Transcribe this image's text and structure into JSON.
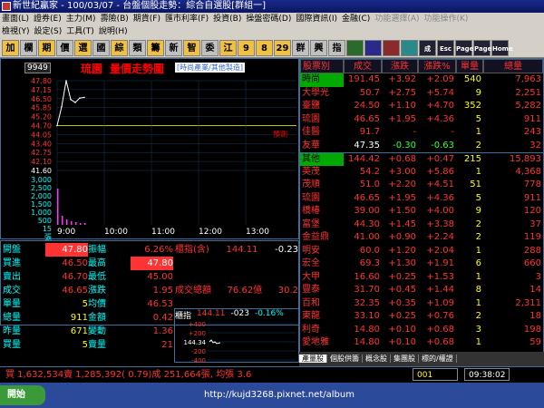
{
  "window": {
    "title": "新世紀贏家 - 100/03/07 - 台盤個股走勢：綜合自選股[群組一]"
  },
  "menu": {
    "row1": [
      "畫面(L)",
      "證券(E)",
      "主力(M)",
      "壽險(B)",
      "期貨(F)",
      "匯市利率(F)",
      "投資(B)",
      "操盤密碼(D)",
      "國際資訊(I)",
      "金融(C)",
      "功能選擇(A)",
      "功能操作(K)"
    ],
    "row2": [
      "檢視(Y)",
      "設定(S)",
      "工具(T)",
      "說明(H)"
    ]
  },
  "toolbar": {
    "buttons": [
      "加",
      "欄",
      "期",
      "價",
      "選",
      "國",
      "綜",
      "類",
      "籌",
      "新",
      "智",
      "委",
      "江",
      "9",
      "8",
      "29",
      "群",
      "興",
      "指",
      "",
      "",
      "",
      "",
      "成",
      "Esc",
      "Page Up",
      "Page Down",
      "Home"
    ]
  },
  "chart": {
    "code": "9949",
    "stock_name": "琉園",
    "chart_label": "量價走勢圖",
    "industry": "[時尚產業/其他製造]",
    "price_ticks": [
      "47.80",
      "47.15",
      "46.50",
      "45.85",
      "45.20",
      "44.70",
      "44.05",
      "43.40",
      "42.75",
      "42.10",
      "41.60"
    ],
    "volume_ticks": [
      "3,000",
      "2,500",
      "2,000",
      "1,500",
      "1,000",
      "500",
      "15",
      "張"
    ],
    "time_ticks": [
      "9:00",
      "10:00",
      "11:00",
      "12:00",
      "13:00"
    ],
    "extra_label": "預測"
  },
  "chart_data": {
    "type": "line",
    "x": [
      "9:00",
      "9:05",
      "9:10",
      "9:15",
      "9:20",
      "9:25",
      "9:30"
    ],
    "series": [
      {
        "values": [
          44.7,
          46.0,
          47.8,
          46.5,
          46.3,
          46.6,
          46.65
        ]
      }
    ],
    "ylim": [
      41.6,
      47.8
    ]
  },
  "info": {
    "left": [
      {
        "l": "開盤",
        "v1": "47.80",
        "l2": "振幅",
        "v2": "6.26%"
      },
      {
        "l": "買進",
        "v1": "46.50",
        "l2": "最高",
        "v2": "47.80"
      },
      {
        "l": "賣出",
        "v1": "46.70",
        "l2": "最低",
        "v2": "45.00"
      },
      {
        "l": "成交",
        "v1": "46.65",
        "l2": "漲跌",
        "v2": "1.95"
      },
      {
        "l": "單量",
        "v1": "5",
        "l2": "均價",
        "v2": "46.53"
      },
      {
        "l": "總量",
        "v1": "911",
        "l2": "金額",
        "v2": "0.42"
      },
      {
        "l": "昨量",
        "v1": "671",
        "l2": "變動",
        "v2": "1.36"
      },
      {
        "l": "買量",
        "v1": "5",
        "l2": "賣量",
        "v2": "21"
      }
    ],
    "right": {
      "index_label": "櫃指(含)",
      "index_val": "144.11",
      "index_chg": "-0.23",
      "total_label": "成交總額",
      "total_val": "76.62億",
      "total_pct": "30.2",
      "mini_label": "櫃指",
      "mini_val": "144.11",
      "mini_chg": "-023",
      "mini_pct": "-0.16%",
      "mini_ticks": [
        "+400",
        "+200",
        "144.34",
        "-200",
        "-400"
      ]
    }
  },
  "watchlist": {
    "headers": [
      "股票別",
      "成交",
      "漲跌",
      "漲跌%",
      "單量",
      "總量"
    ],
    "rows": [
      [
        "時尚",
        "191.45",
        "+3.92",
        "+2.09",
        "540",
        "7,963"
      ],
      [
        "大學光",
        "50.7",
        "+2.75",
        "+5.74",
        "9",
        "2,251"
      ],
      [
        "臺鹽",
        "24.50",
        "+1.10",
        "+4.70",
        "352",
        "5,282"
      ],
      [
        "琉園",
        "46.65",
        "+1.95",
        "+4.36",
        "5",
        "911"
      ],
      [
        "佳醫",
        "91.7",
        "-",
        "-",
        "1",
        "243"
      ],
      [
        "友華",
        "47.35",
        "-0.30",
        "-0.63",
        "2",
        "32"
      ],
      [
        "其他",
        "144.42",
        "+0.68",
        "+0.47",
        "215",
        "15,893"
      ],
      [
        "英茂",
        "54.2",
        "+3.00",
        "+5.86",
        "1",
        "4,368"
      ],
      [
        "茂順",
        "51.0",
        "+2.20",
        "+4.51",
        "51",
        "778"
      ],
      [
        "琉園",
        "46.65",
        "+1.95",
        "+4.36",
        "5",
        "911"
      ],
      [
        "橋椿",
        "39.00",
        "+1.50",
        "+4.00",
        "9",
        "120"
      ],
      [
        "富堡",
        "44.30",
        "+1.45",
        "+3.38",
        "2",
        "37"
      ],
      [
        "金益鼎",
        "41.00",
        "+0.90",
        "+2.24",
        "2",
        "119"
      ],
      [
        "明安",
        "60.0",
        "+1.20",
        "+2.04",
        "1",
        "288"
      ],
      [
        "宏全",
        "69.3",
        "+1.30",
        "+1.91",
        "6",
        "660"
      ],
      [
        "大甲",
        "16.60",
        "+0.25",
        "+1.53",
        "1",
        "3"
      ],
      [
        "豐泰",
        "31.70",
        "+0.45",
        "+1.44",
        "8",
        "14"
      ],
      [
        "百和",
        "32.35",
        "+0.35",
        "+1.09",
        "1",
        "2,311"
      ],
      [
        "東龍",
        "33.10",
        "+0.25",
        "+0.76",
        "2",
        "18"
      ],
      [
        "利奇",
        "14.80",
        "+0.10",
        "+0.68",
        "3",
        "198"
      ],
      [
        "愛地雅",
        "14.80",
        "+0.10",
        "+0.68",
        "1",
        "59"
      ]
    ]
  },
  "tabs": [
    "產量股",
    "個股供籌",
    "概念股",
    "集團股",
    "標的/權證"
  ],
  "status": {
    "text": "買 1,632,534賣 1,285,392( 0.79)成 251,664張, 均張 3.6",
    "code": "001",
    "clock": "09:38:02"
  },
  "taskbar": {
    "start": "開始",
    "url": "http://kujd3268.pixnet.net/album"
  }
}
